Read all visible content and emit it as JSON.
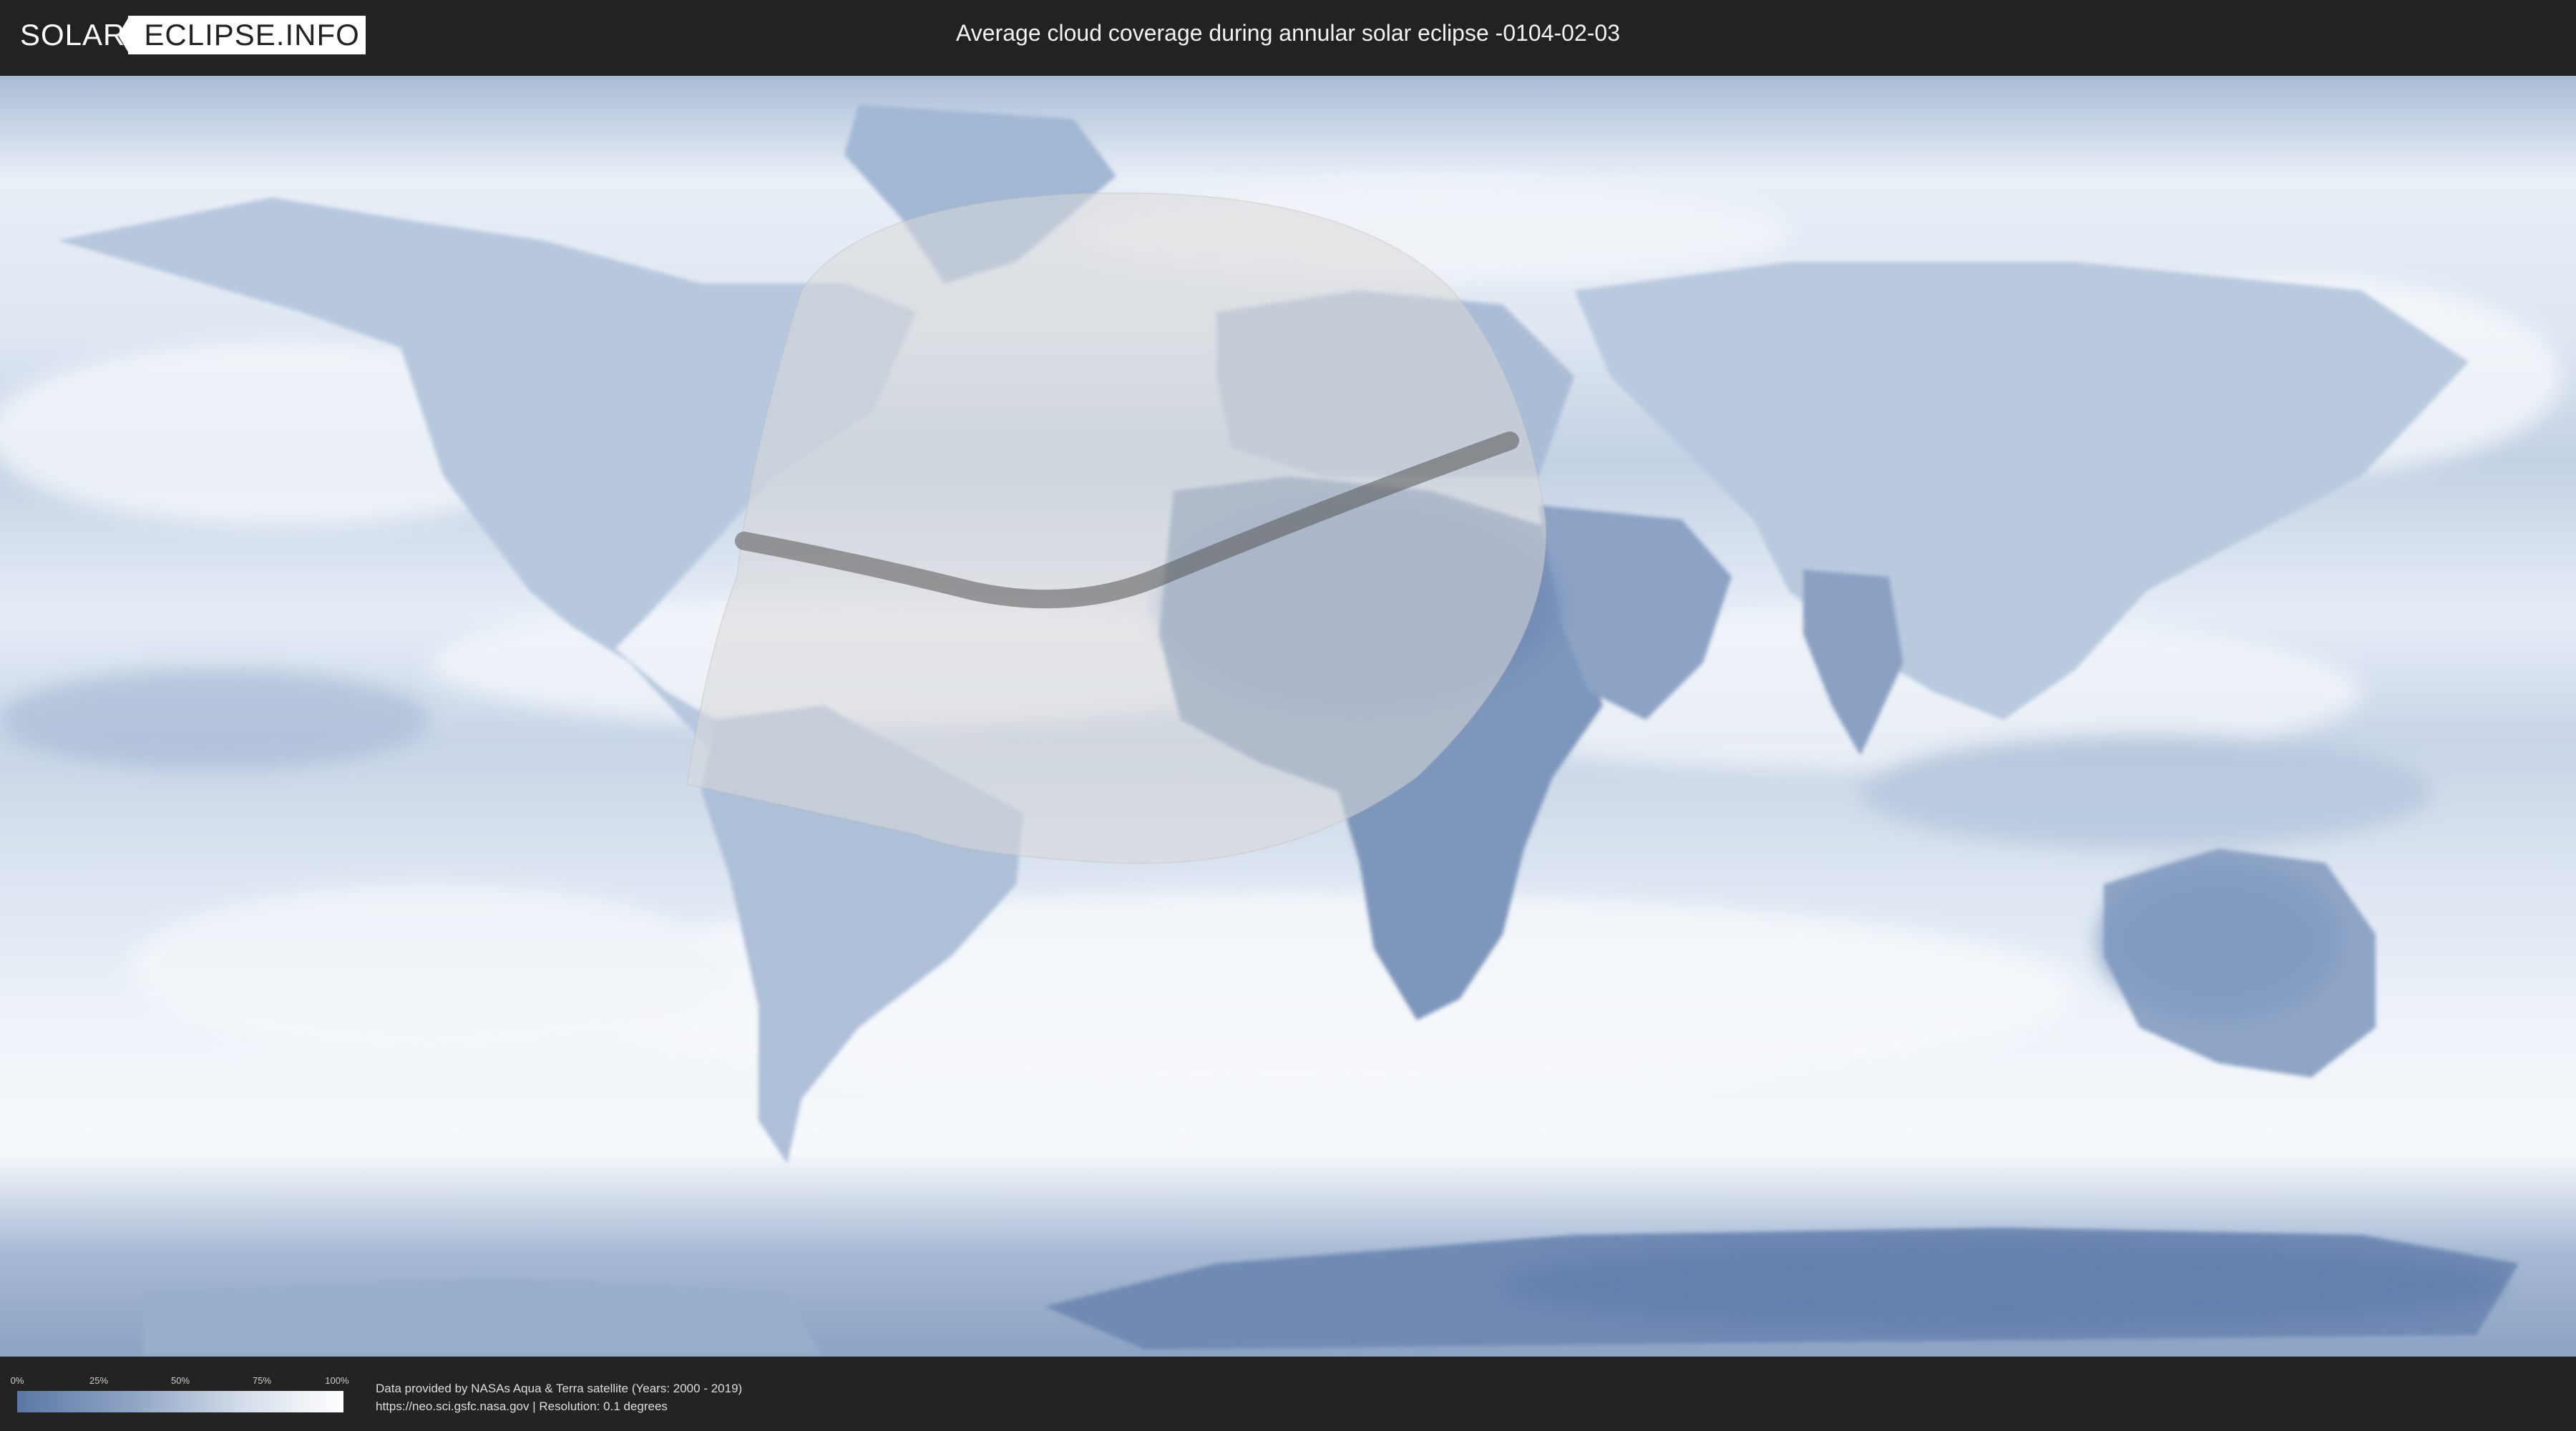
{
  "header": {
    "logo_left": "SOLAR",
    "logo_right": "ECLIPSE.INFO",
    "title": "Average cloud coverage during annular solar eclipse -0104-02-03"
  },
  "legend": {
    "ticks": [
      "0%",
      "25%",
      "50%",
      "75%",
      "100%"
    ],
    "gradient_colors": [
      "#5b78a5",
      "#ffffff"
    ]
  },
  "credits": {
    "line1": "Data provided by NASAs Aqua & Terra satellite (Years: 2000 - 2019)",
    "line2": "https://neo.sci.gsfc.nasa.gov | Resolution: 0.1 degrees"
  },
  "colors": {
    "header_bg": "#222222",
    "cloud_light": "#f4f7fb",
    "cloud_dark": "#5b78a5",
    "eclipse_shade": "#d9d9d9",
    "central_path": "#555555"
  }
}
